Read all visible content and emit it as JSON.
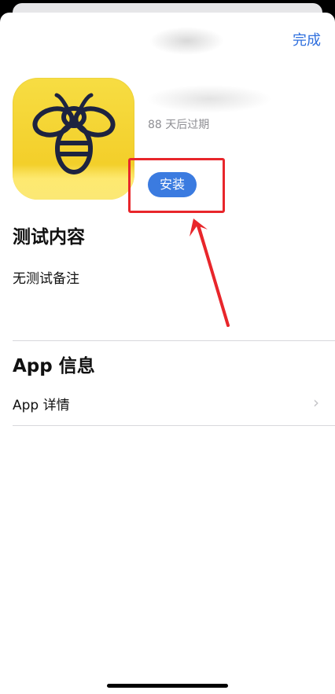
{
  "header": {
    "done_label": "完成"
  },
  "app": {
    "icon": "bee-icon",
    "expiry_text": "88 天后过期",
    "install_label": "安装"
  },
  "test_section": {
    "title": "测试内容",
    "notes": "无测试备注"
  },
  "info_section": {
    "title": "App 信息",
    "details_label": "App 详情",
    "chevron_icon": "chevron-right-icon"
  },
  "colors": {
    "accent": "#2f6fde",
    "install_button": "#3b7be0",
    "annotation": "#e8262b",
    "icon_yellow": "#f3cf2a",
    "bee_navy": "#1d2340"
  }
}
